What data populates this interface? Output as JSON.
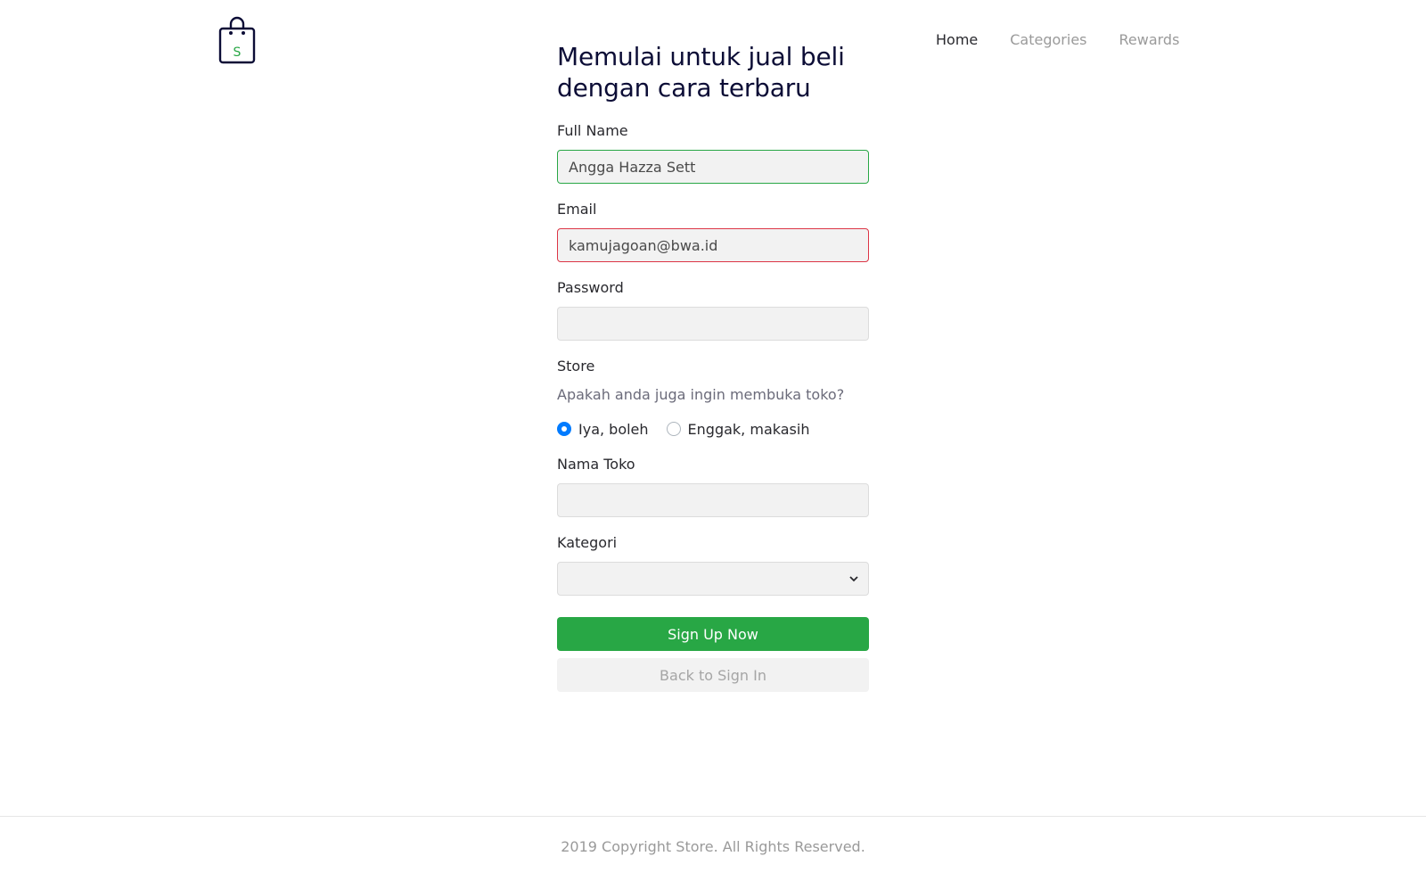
{
  "nav": {
    "items": [
      {
        "label": "Home",
        "active": true
      },
      {
        "label": "Categories",
        "active": false
      },
      {
        "label": "Rewards",
        "active": false
      }
    ]
  },
  "logo": {
    "letter": "S",
    "icon": "shopping-bag-icon",
    "accent": "#28a745"
  },
  "form": {
    "title_line1": "Memulai untuk jual beli",
    "title_line2": "dengan cara terbaru",
    "full_name": {
      "label": "Full Name",
      "value": "Angga Hazza Sett"
    },
    "email": {
      "label": "Email",
      "value": "kamujagoan@bwa.id"
    },
    "password": {
      "label": "Password",
      "value": ""
    },
    "store": {
      "label": "Store",
      "question": "Apakah anda juga ingin membuka toko?",
      "options": [
        {
          "label": "Iya, boleh",
          "checked": true
        },
        {
          "label": "Enggak, makasih",
          "checked": false
        }
      ]
    },
    "store_name": {
      "label": "Nama Toko",
      "value": ""
    },
    "category": {
      "label": "Kategori",
      "value": ""
    },
    "signup_label": "Sign Up Now",
    "back_label": "Back to Sign In"
  },
  "footer": {
    "copyright": "2019 Copyright Store. All Rights Reserved."
  },
  "colors": {
    "success": "#28a745",
    "danger": "#dc3545",
    "radio": "#007bff"
  }
}
